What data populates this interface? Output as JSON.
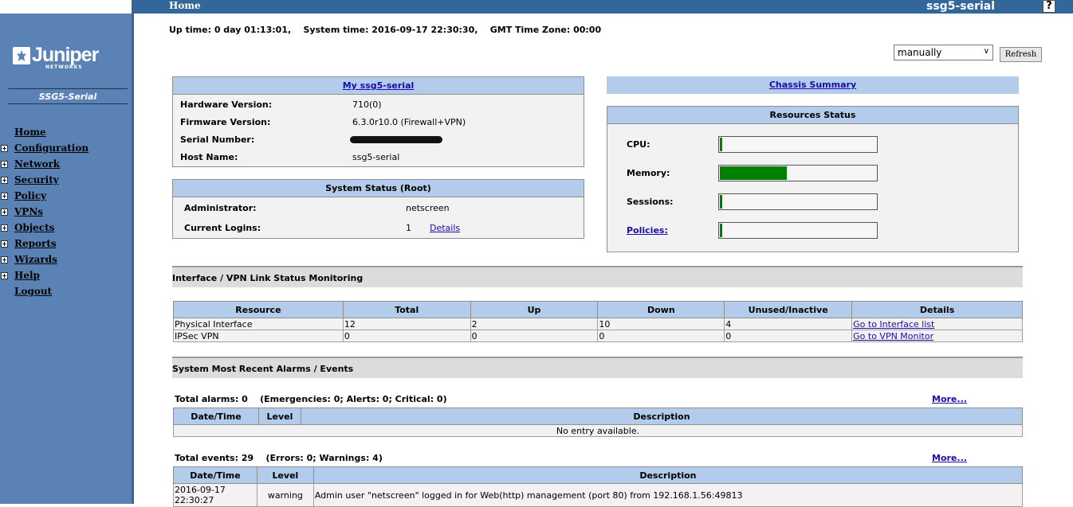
{
  "header": {
    "page": "Home",
    "device": "ssg5-serial",
    "help": "?"
  },
  "sidebar": {
    "logo_text": "Juniper",
    "logo_sub": "NETWORKS",
    "model": "SSG5-Serial",
    "items": [
      {
        "label": "Home",
        "expandable": false
      },
      {
        "label": "Configuration",
        "expandable": true
      },
      {
        "label": "Network",
        "expandable": true
      },
      {
        "label": "Security",
        "expandable": true
      },
      {
        "label": "Policy",
        "expandable": true
      },
      {
        "label": "VPNs",
        "expandable": true
      },
      {
        "label": "Objects",
        "expandable": true
      },
      {
        "label": "Reports",
        "expandable": true
      },
      {
        "label": "Wizards",
        "expandable": true
      },
      {
        "label": "Help",
        "expandable": true
      },
      {
        "label": "Logout",
        "expandable": false
      }
    ]
  },
  "status_line": "Up time: 0 day 01:13:01,    System time: 2016-09-17 22:30:30,    GMT Time Zone: 00:00",
  "refresh": {
    "mode": "manually",
    "button": "Refresh"
  },
  "device_panel": {
    "title": "My ssg5-serial",
    "rows": [
      {
        "label": "Hardware Version:",
        "value": "710(0)"
      },
      {
        "label": "Firmware Version:",
        "value": "6.3.0r10.0 (Firewall+VPN)"
      },
      {
        "label": "Serial Number:",
        "value": ""
      },
      {
        "label": "Host Name:",
        "value": "ssg5-serial"
      }
    ]
  },
  "system_status": {
    "title": "System Status  (Root)",
    "admin_label": "Administrator:",
    "admin_value": "netscreen",
    "logins_label": "Current Logins:",
    "logins_value": "1",
    "details_link": "Details"
  },
  "chassis": {
    "title": "Chassis Summary"
  },
  "resources": {
    "title": "Resources Status",
    "items": [
      {
        "label": "CPU:",
        "fraction": 0.01,
        "link": false
      },
      {
        "label": "Memory:",
        "fraction": 0.43,
        "link": false
      },
      {
        "label": "Sessions:",
        "fraction": 0.01,
        "link": false
      },
      {
        "label": "Policies:",
        "fraction": 0.01,
        "link": true
      }
    ]
  },
  "interface_section": {
    "title": "Interface / VPN Link Status Monitoring",
    "columns": [
      "Resource",
      "Total",
      "Up",
      "Down",
      "Unused/Inactive",
      "Details"
    ],
    "rows": [
      [
        "Physical Interface",
        "12",
        "2",
        "10",
        "4",
        "Go to Interface list"
      ],
      [
        "IPSec VPN",
        "0",
        "0",
        "0",
        "0",
        "Go to VPN Monitor"
      ]
    ]
  },
  "alarms_section": {
    "title": "System Most Recent Alarms   /   Events",
    "alarms_total": "Total alarms: 0    (Emergencies: 0; Alerts: 0; Critical: 0)",
    "more": "More...",
    "columns": [
      "Date/Time",
      "Level",
      "Description"
    ],
    "empty": "No entry available.",
    "events_total": "Total events: 29    (Errors: 0; Warnings: 4)",
    "events_more": "More...",
    "event_columns": [
      "Date/Time",
      "Level",
      "Description"
    ],
    "events": [
      {
        "date": "2016-09-17",
        "time": "22:30:27",
        "level": "warning",
        "description": "Admin user \"netscreen\" logged in for Web(http) management (port 80) from 192.168.1.56:49813"
      }
    ]
  }
}
